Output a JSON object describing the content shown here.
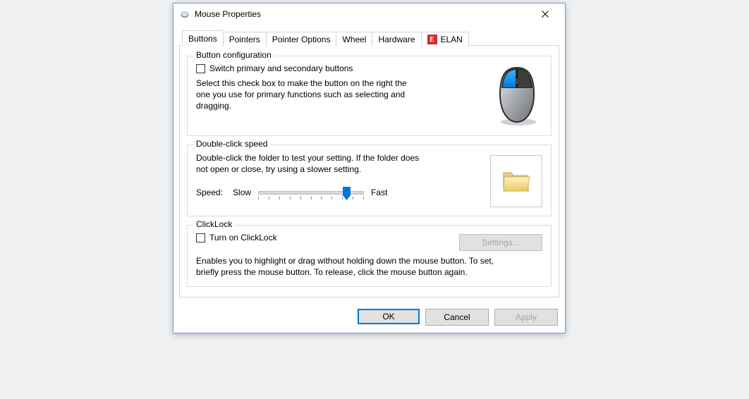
{
  "window": {
    "title": "Mouse Properties"
  },
  "tabs": [
    {
      "label": "Buttons"
    },
    {
      "label": "Pointers"
    },
    {
      "label": "Pointer Options"
    },
    {
      "label": "Wheel"
    },
    {
      "label": "Hardware"
    },
    {
      "label": "ELAN"
    }
  ],
  "button_config": {
    "title": "Button configuration",
    "checkbox_label": "Switch primary and secondary buttons",
    "description": "Select this check box to make the button on the right the one you use for primary functions such as selecting and dragging."
  },
  "double_click": {
    "title": "Double-click speed",
    "description": "Double-click the folder to test your setting. If the folder does not open or close, try using a slower setting.",
    "speed_label": "Speed:",
    "slow_label": "Slow",
    "fast_label": "Fast"
  },
  "clicklock": {
    "title": "ClickLock",
    "checkbox_label": "Turn on ClickLock",
    "settings_label": "Settings...",
    "description": "Enables you to highlight or drag without holding down the mouse button. To set, briefly press the mouse button. To release, click the mouse button again."
  },
  "buttons": {
    "ok": "OK",
    "cancel": "Cancel",
    "apply": "Apply"
  }
}
